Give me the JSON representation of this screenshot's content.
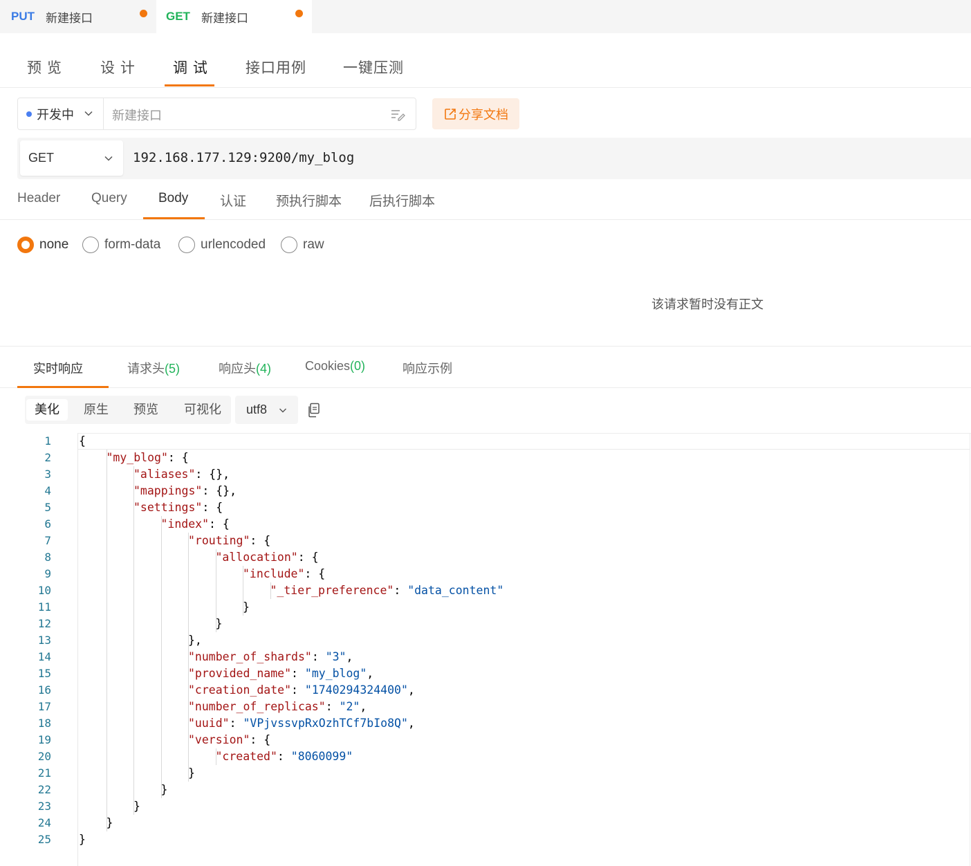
{
  "doc_tabs": [
    {
      "method": "PUT",
      "name": "新建接口"
    },
    {
      "method": "GET",
      "name": "新建接口"
    }
  ],
  "mode_tabs": [
    "预 览",
    "设 计",
    "调 试",
    "接口用例",
    "一键压测"
  ],
  "status": "开发中",
  "name_placeholder": "新建接口",
  "share_label": "分享文档",
  "request": {
    "method": "GET",
    "url": "192.168.177.129:9200/my_blog"
  },
  "param_tabs": [
    "Header",
    "Query",
    "Body",
    "认证",
    "预执行脚本",
    "后执行脚本"
  ],
  "body_types": [
    "none",
    "form-data",
    "urlencoded",
    "raw"
  ],
  "body_empty_text": "该请求暂时没有正文",
  "response_tabs": [
    {
      "label": "实时响应",
      "count": ""
    },
    {
      "label": "请求头",
      "count": "(5)"
    },
    {
      "label": "响应头",
      "count": "(4)"
    },
    {
      "label": "Cookies",
      "count": "(0)"
    },
    {
      "label": "响应示例",
      "count": ""
    }
  ],
  "view_modes": [
    "美化",
    "原生",
    "预览",
    "可视化"
  ],
  "encoding": "utf8",
  "response_lines": [
    [
      [
        "p",
        "{"
      ]
    ],
    [
      [
        "k",
        "\"my_blog\""
      ],
      [
        "p",
        ": {"
      ]
    ],
    [
      [
        "k",
        "\"aliases\""
      ],
      [
        "p",
        ": {},"
      ]
    ],
    [
      [
        "k",
        "\"mappings\""
      ],
      [
        "p",
        ": {},"
      ]
    ],
    [
      [
        "k",
        "\"settings\""
      ],
      [
        "p",
        ": {"
      ]
    ],
    [
      [
        "k",
        "\"index\""
      ],
      [
        "p",
        ": {"
      ]
    ],
    [
      [
        "k",
        "\"routing\""
      ],
      [
        "p",
        ": {"
      ]
    ],
    [
      [
        "k",
        "\"allocation\""
      ],
      [
        "p",
        ": {"
      ]
    ],
    [
      [
        "k",
        "\"include\""
      ],
      [
        "p",
        ": {"
      ]
    ],
    [
      [
        "k",
        "\"_tier_preference\""
      ],
      [
        "p",
        ": "
      ],
      [
        "s",
        "\"data_content\""
      ]
    ],
    [
      [
        "p",
        "}"
      ]
    ],
    [
      [
        "p",
        "}"
      ]
    ],
    [
      [
        "p",
        "},"
      ]
    ],
    [
      [
        "k",
        "\"number_of_shards\""
      ],
      [
        "p",
        ": "
      ],
      [
        "s",
        "\"3\""
      ],
      [
        "p",
        ","
      ]
    ],
    [
      [
        "k",
        "\"provided_name\""
      ],
      [
        "p",
        ": "
      ],
      [
        "s",
        "\"my_blog\""
      ],
      [
        "p",
        ","
      ]
    ],
    [
      [
        "k",
        "\"creation_date\""
      ],
      [
        "p",
        ": "
      ],
      [
        "s",
        "\"1740294324400\""
      ],
      [
        "p",
        ","
      ]
    ],
    [
      [
        "k",
        "\"number_of_replicas\""
      ],
      [
        "p",
        ": "
      ],
      [
        "s",
        "\"2\""
      ],
      [
        "p",
        ","
      ]
    ],
    [
      [
        "k",
        "\"uuid\""
      ],
      [
        "p",
        ": "
      ],
      [
        "s",
        "\"VPjvssvpRxOzhTCf7bIo8Q\""
      ],
      [
        "p",
        ","
      ]
    ],
    [
      [
        "k",
        "\"version\""
      ],
      [
        "p",
        ": {"
      ]
    ],
    [
      [
        "k",
        "\"created\""
      ],
      [
        "p",
        ": "
      ],
      [
        "s",
        "\"8060099\""
      ]
    ],
    [
      [
        "p",
        "}"
      ]
    ],
    [
      [
        "p",
        "}"
      ]
    ],
    [
      [
        "p",
        "}"
      ]
    ],
    [
      [
        "p",
        "}"
      ]
    ],
    [
      [
        "p",
        "}"
      ]
    ]
  ],
  "colors": {
    "accent": "#f2770e",
    "get_method": "#21b35a",
    "put_method": "#3a7be5",
    "json_key": "#a31515",
    "json_string": "#0451a5",
    "line_number": "#237893"
  }
}
